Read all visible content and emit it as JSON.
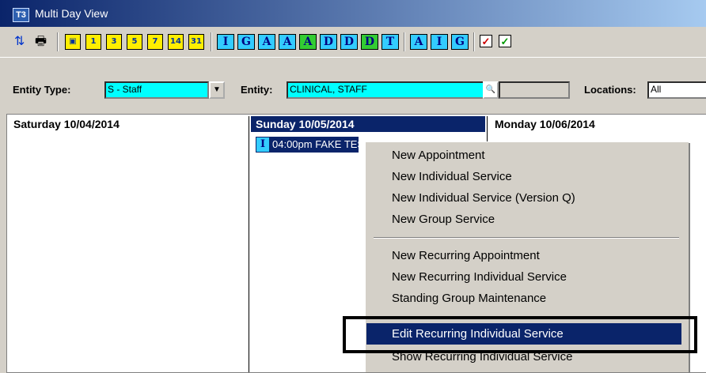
{
  "window": {
    "title": "Multi Day View",
    "icon_text": "T3"
  },
  "toolbar": {
    "day_buttons": [
      "1",
      "3",
      "5",
      "7",
      "14",
      "31"
    ],
    "letter_buttons": [
      "I",
      "G",
      "A",
      "A",
      "A",
      "D",
      "D",
      "D",
      "T"
    ],
    "letter_buttons_2": [
      "A",
      "I",
      "G"
    ],
    "icons": [
      "refresh-icon",
      "print-icon",
      "calendar-today-icon",
      "checkbox-icon"
    ]
  },
  "filters": {
    "entity_type_label": "Entity Type:",
    "entity_type_value": "S - Staff",
    "entity_label": "Entity:",
    "entity_value": "CLINICAL, STAFF",
    "locations_label": "Locations:",
    "locations_value": "All"
  },
  "days": [
    {
      "label": "Saturday 10/04/2014"
    },
    {
      "label": "Sunday 10/05/2014"
    },
    {
      "label": "Monday 10/06/2014"
    }
  ],
  "appointment": {
    "icon_letter": "I",
    "text": "04:00pm FAKE TEST ASSESSM"
  },
  "context_menu": {
    "group1": [
      "New Appointment",
      "New Individual Service",
      "New Individual Service (Version Q)",
      "New Group Service"
    ],
    "group2": [
      "New Recurring Appointment",
      "New Recurring Individual Service",
      "Standing Group Maintenance"
    ],
    "group3": [
      "Edit Recurring Individual Service",
      "Show Recurring Individual Service"
    ]
  },
  "colors": {
    "title_start": "#0a246a",
    "title_end": "#a6caf0",
    "field_bg": "#00ffff",
    "selection": "#0a246a"
  }
}
